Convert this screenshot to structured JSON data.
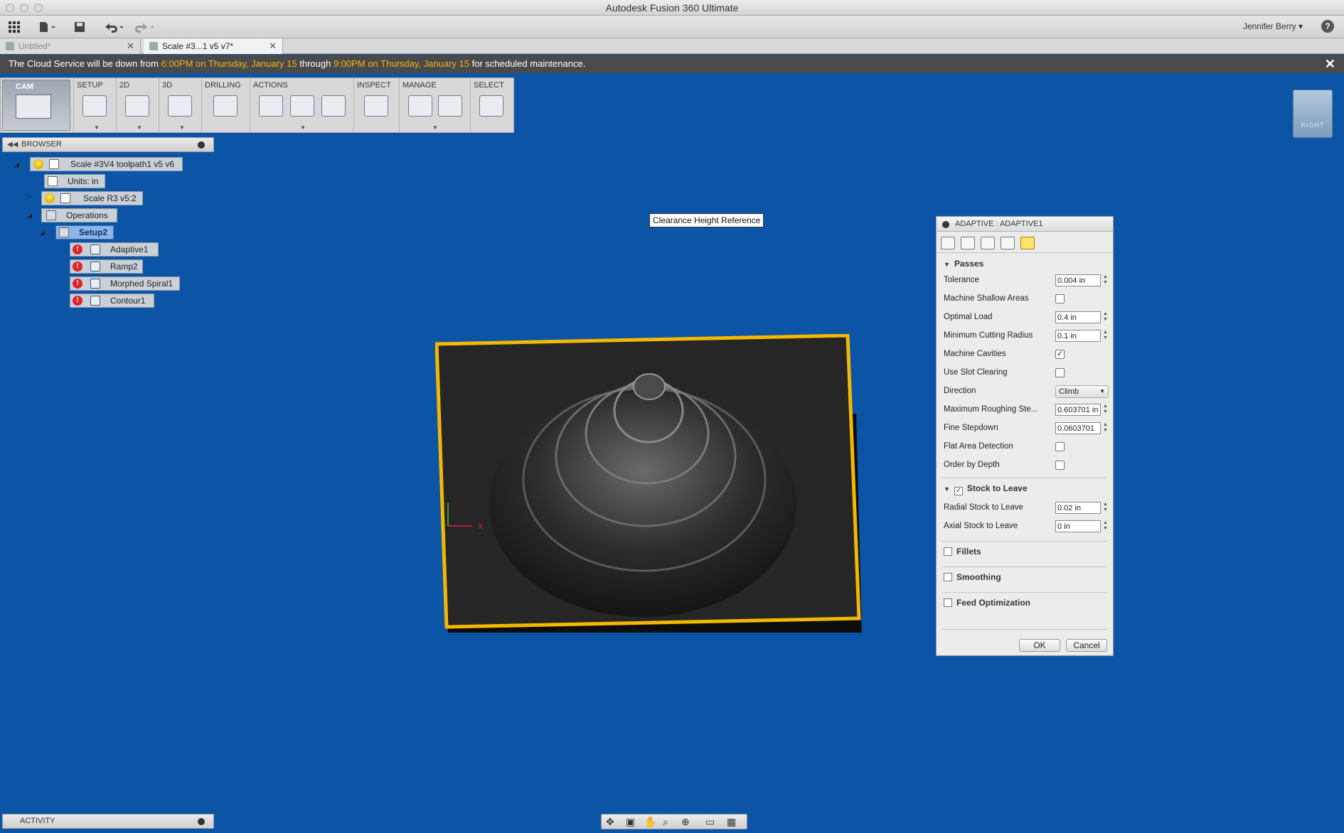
{
  "window": {
    "title": "Autodesk Fusion 360 Ultimate"
  },
  "toolbar": {
    "user": "Jennifer Berry",
    "help": "?"
  },
  "tabs": [
    {
      "label": "Untitled*",
      "active": false
    },
    {
      "label": "Scale #3...1 v5 v7*",
      "active": true
    }
  ],
  "notice": {
    "part1": "The Cloud Service will be down from ",
    "start": "6:00PM on Thursday, January 15",
    "part2": " through ",
    "end": "9:00PM on Thursday, January 15",
    "part3": " for scheduled maintenance."
  },
  "ribbon": {
    "workspace": "CAM",
    "groups": [
      "SETUP",
      "2D",
      "3D",
      "DRILLING",
      "ACTIONS",
      "INSPECT",
      "MANAGE",
      "SELECT"
    ]
  },
  "browser": {
    "title": "BROWSER",
    "root": "Scale #3V4 toolpath1 v5 v6",
    "units": "Units: in",
    "component": "Scale R3 v5:2",
    "operations": "Operations",
    "setup": "Setup2",
    "ops": [
      "Adaptive1",
      "Ramp2",
      "Morphed Spiral1",
      "Contour1"
    ]
  },
  "viewport": {
    "tooltip": "Clearance Height Reference",
    "viewcube_label": "RIGHT",
    "axis_x": "X"
  },
  "dialog": {
    "title": "ADAPTIVE : ADAPTIVE1",
    "passes": {
      "title": "Passes",
      "tolerance_label": "Tolerance",
      "tolerance": "0.004 in",
      "shallow_label": "Machine Shallow Areas",
      "load_label": "Optimal Load",
      "load": "0.4 in",
      "radius_label": "Minimum Cutting Radius",
      "radius": "0.1 in",
      "cavities_label": "Machine Cavities",
      "slot_label": "Use Slot Clearing",
      "direction_label": "Direction",
      "direction": "Climb",
      "maxstep_label": "Maximum Roughing Ste...",
      "maxstep": "0.603701 in",
      "finestep_label": "Fine Stepdown",
      "finestep": "0.0603701",
      "flat_label": "Flat Area Detection",
      "order_label": "Order by Depth"
    },
    "stock": {
      "title": "Stock to Leave",
      "radial_label": "Radial Stock to Leave",
      "radial": "0.02 in",
      "axial_label": "Axial Stock to Leave",
      "axial": "0 in"
    },
    "fillets": "Fillets",
    "smoothing": "Smoothing",
    "feed": "Feed Optimization",
    "ok": "OK",
    "cancel": "Cancel"
  },
  "activity": {
    "title": "ACTIVITY"
  },
  "colors": {
    "viewport": "#0b54a6",
    "highlight": "#f2b31c",
    "stock_outline": "#f5b800",
    "error": "#e0222a"
  }
}
